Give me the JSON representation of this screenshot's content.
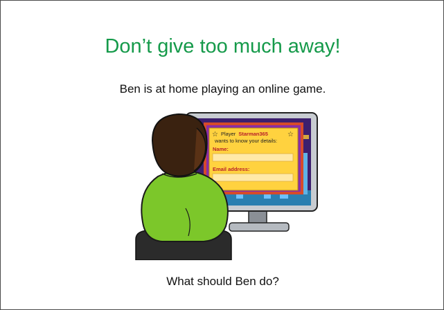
{
  "slide": {
    "title": "Don’t give too much away!",
    "subtitle": "Ben is at home playing an online game.",
    "question": "What should Ben do?"
  },
  "popup": {
    "line1_prefix": "Player",
    "player_name": "Starman365",
    "line2": "wants to know your details:",
    "name_label": "Name:",
    "email_label": "Email address:",
    "name_value": "",
    "email_value": ""
  },
  "colors": {
    "title": "#159a4a",
    "popup_bg": "#ffd23f",
    "label_red": "#b8202a",
    "shirt": "#7cc72a",
    "skin": "#4a2a12"
  },
  "icons": [
    "star-icon"
  ]
}
